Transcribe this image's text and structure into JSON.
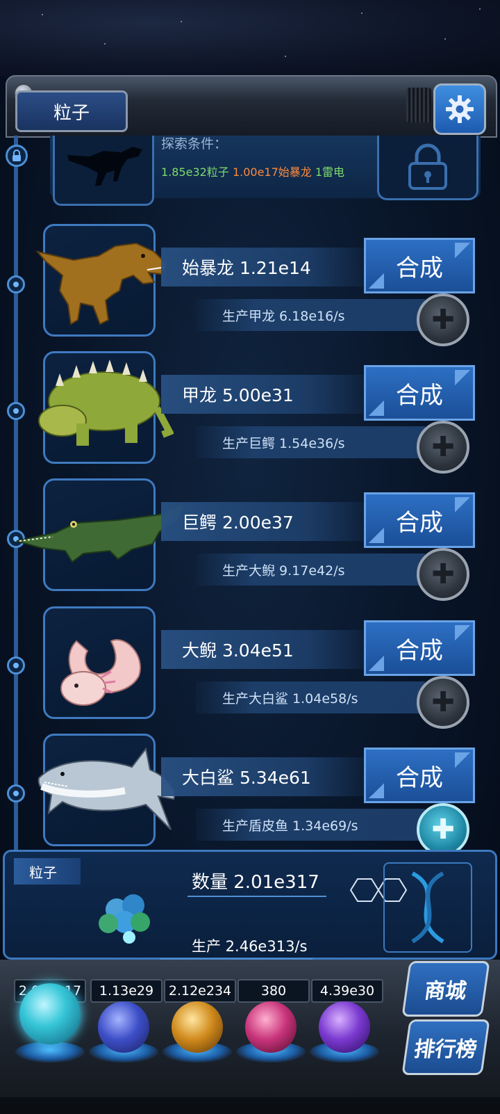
{
  "header": {
    "title": "粒子",
    "settings_icon": "gear-icon"
  },
  "locked": {
    "title": "探索条件：",
    "conditions": [
      {
        "text": "1.85e32粒子",
        "color": "#7ddc6a"
      },
      {
        "text": "1.00e17始暴龙",
        "color": "#ff8a3d"
      },
      {
        "text": "1雷电",
        "color": "#7ddc6a"
      }
    ]
  },
  "creatures": [
    {
      "name": "始暴龙 1.21e14",
      "production": "生产甲龙 6.18e16/s",
      "synth_label": "合成",
      "plus_active": false
    },
    {
      "name": "甲龙 5.00e31",
      "production": "生产巨鳄 1.54e36/s",
      "synth_label": "合成",
      "plus_active": false
    },
    {
      "name": "巨鳄 2.00e37",
      "production": "生产大鲵 9.17e42/s",
      "synth_label": "合成",
      "plus_active": false
    },
    {
      "name": "大鲵 3.04e51",
      "production": "生产大白鲨 1.04e58/s",
      "synth_label": "合成",
      "plus_active": false
    },
    {
      "name": "大白鲨 5.34e61",
      "production": "生产盾皮鱼 1.34e69/s",
      "synth_label": "合成",
      "plus_active": true
    }
  ],
  "particle": {
    "tag": "粒子",
    "count": "数量 2.01e317",
    "production": "生产 2.46e313/s"
  },
  "resources": {
    "values": [
      "2.01e317",
      "1.13e29",
      "2.12e234",
      "380",
      "4.39e30"
    ],
    "orb_colors": [
      "#36c6d8",
      "#3d4fc8",
      "#d08a1c",
      "#c8347a",
      "#7a3ad0"
    ]
  },
  "side_buttons": {
    "shop": "商城",
    "ranking": "排行榜"
  }
}
